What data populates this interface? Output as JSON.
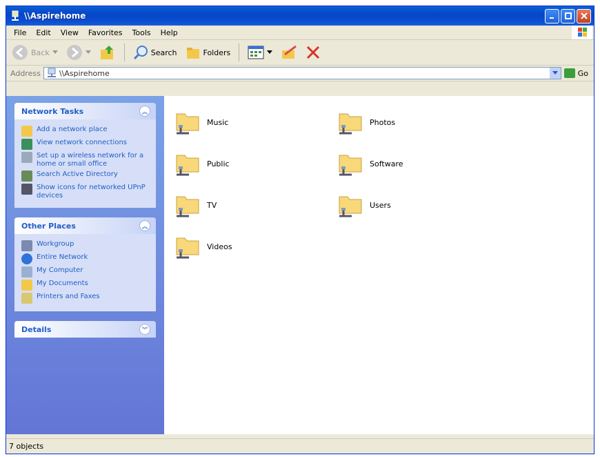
{
  "window": {
    "title": "\\\\Aspirehome"
  },
  "menu": [
    "File",
    "Edit",
    "View",
    "Favorites",
    "Tools",
    "Help"
  ],
  "toolbar": {
    "back": "Back",
    "search": "Search",
    "folders": "Folders"
  },
  "address": {
    "label": "Address",
    "value": "\\\\Aspirehome",
    "go": "Go"
  },
  "panels": {
    "network_tasks": {
      "title": "Network Tasks",
      "items": [
        {
          "label": "Add a network place"
        },
        {
          "label": "View network connections"
        },
        {
          "label": "Set up a wireless network for a home or small office"
        },
        {
          "label": "Search Active Directory"
        },
        {
          "label": "Show icons for networked UPnP devices"
        }
      ]
    },
    "other_places": {
      "title": "Other Places",
      "items": [
        {
          "label": "Workgroup"
        },
        {
          "label": "Entire Network"
        },
        {
          "label": "My Computer"
        },
        {
          "label": "My Documents"
        },
        {
          "label": "Printers and Faxes"
        }
      ]
    },
    "details": {
      "title": "Details"
    }
  },
  "folders": [
    {
      "label": "Music"
    },
    {
      "label": "Photos"
    },
    {
      "label": "Public"
    },
    {
      "label": "Software"
    },
    {
      "label": "TV"
    },
    {
      "label": "Users"
    },
    {
      "label": "Videos"
    }
  ],
  "status": {
    "text": "7 objects"
  },
  "colors": {
    "titlebar": "#0a5fd8",
    "taskpane": "#7ba2e7",
    "link": "#215dc6"
  }
}
